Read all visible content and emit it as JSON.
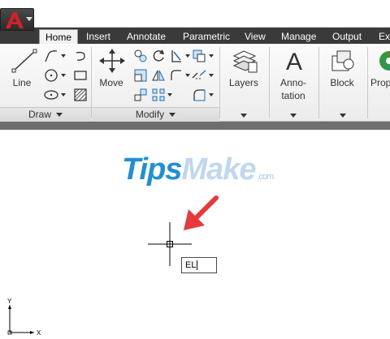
{
  "tabs": [
    {
      "label": "Home",
      "active": true
    },
    {
      "label": "Insert"
    },
    {
      "label": "Annotate"
    },
    {
      "label": "Parametric"
    },
    {
      "label": "View"
    },
    {
      "label": "Manage"
    },
    {
      "label": "Output"
    },
    {
      "label": "Ex"
    }
  ],
  "ribbon": {
    "draw": {
      "title": "Draw",
      "line_label": "Line"
    },
    "modify": {
      "title": "Modify",
      "move_label": "Move"
    },
    "layers_label": "Layers",
    "annotation_label": "Anno-\ntation",
    "annotation_line1": "Anno-",
    "annotation_line2": "tation",
    "block_label": "Block",
    "properties_label": "Prop"
  },
  "canvas": {
    "watermark_main_a": "Tips",
    "watermark_main_b": "Make",
    "watermark_sub": ".com",
    "command_input_value": "EL",
    "ucs_y_label": "Y",
    "ucs_x_label": "X"
  },
  "colors": {
    "tabbar": "#3a3a3a",
    "arrow": "#e8393a",
    "app_logo": "#d4202a"
  },
  "icons": {
    "app": "autocad-logo-icon",
    "crosshair": "crosshair-cursor-icon",
    "arrow": "red-pointer-arrow"
  }
}
